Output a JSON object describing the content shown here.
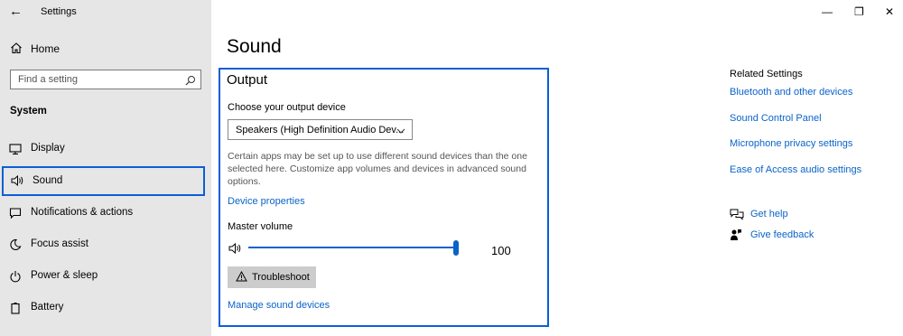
{
  "window": {
    "app_title": "Settings",
    "minimize": "—",
    "restore": "❐",
    "close": "✕"
  },
  "sidebar": {
    "home_label": "Home",
    "search_placeholder": "Find a setting",
    "section_label": "System",
    "items": [
      {
        "label": "Display",
        "icon": "display-icon"
      },
      {
        "label": "Sound",
        "icon": "speaker-icon",
        "active": true
      },
      {
        "label": "Notifications & actions",
        "icon": "notification-icon"
      },
      {
        "label": "Focus assist",
        "icon": "moon-icon"
      },
      {
        "label": "Power & sleep",
        "icon": "power-icon"
      },
      {
        "label": "Battery",
        "icon": "battery-icon"
      }
    ]
  },
  "main": {
    "page_title": "Sound",
    "output": {
      "heading": "Output",
      "choose_label": "Choose your output device",
      "device_selected": "Speakers (High Definition Audio Dev...",
      "info_text": "Certain apps may be set up to use different sound devices than the one selected here. Customize app volumes and devices in advanced sound options.",
      "device_properties": "Device properties",
      "master_volume_label": "Master volume",
      "volume_value": "100",
      "volume_level": 100,
      "troubleshoot_label": "Troubleshoot",
      "manage_devices": "Manage sound devices"
    }
  },
  "related": {
    "heading": "Related Settings",
    "links": [
      "Bluetooth and other devices",
      "Sound Control Panel",
      "Microphone privacy settings",
      "Ease of Access audio settings"
    ],
    "get_help": "Get help",
    "give_feedback": "Give feedback"
  },
  "colors": {
    "accent": "#0a63c9",
    "focus_border": "#0a5fd6",
    "sidebar_bg": "#e6e6e6",
    "button_bg": "#cccccc"
  }
}
